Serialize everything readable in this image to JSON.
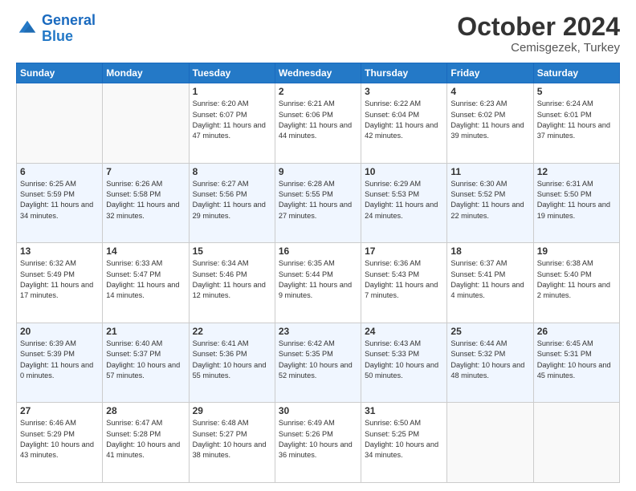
{
  "header": {
    "logo_line1": "General",
    "logo_line2": "Blue",
    "month": "October 2024",
    "location": "Cemisgezek, Turkey"
  },
  "weekdays": [
    "Sunday",
    "Monday",
    "Tuesday",
    "Wednesday",
    "Thursday",
    "Friday",
    "Saturday"
  ],
  "weeks": [
    [
      {
        "day": "",
        "info": ""
      },
      {
        "day": "",
        "info": ""
      },
      {
        "day": "1",
        "info": "Sunrise: 6:20 AM\nSunset: 6:07 PM\nDaylight: 11 hours and 47 minutes."
      },
      {
        "day": "2",
        "info": "Sunrise: 6:21 AM\nSunset: 6:06 PM\nDaylight: 11 hours and 44 minutes."
      },
      {
        "day": "3",
        "info": "Sunrise: 6:22 AM\nSunset: 6:04 PM\nDaylight: 11 hours and 42 minutes."
      },
      {
        "day": "4",
        "info": "Sunrise: 6:23 AM\nSunset: 6:02 PM\nDaylight: 11 hours and 39 minutes."
      },
      {
        "day": "5",
        "info": "Sunrise: 6:24 AM\nSunset: 6:01 PM\nDaylight: 11 hours and 37 minutes."
      }
    ],
    [
      {
        "day": "6",
        "info": "Sunrise: 6:25 AM\nSunset: 5:59 PM\nDaylight: 11 hours and 34 minutes."
      },
      {
        "day": "7",
        "info": "Sunrise: 6:26 AM\nSunset: 5:58 PM\nDaylight: 11 hours and 32 minutes."
      },
      {
        "day": "8",
        "info": "Sunrise: 6:27 AM\nSunset: 5:56 PM\nDaylight: 11 hours and 29 minutes."
      },
      {
        "day": "9",
        "info": "Sunrise: 6:28 AM\nSunset: 5:55 PM\nDaylight: 11 hours and 27 minutes."
      },
      {
        "day": "10",
        "info": "Sunrise: 6:29 AM\nSunset: 5:53 PM\nDaylight: 11 hours and 24 minutes."
      },
      {
        "day": "11",
        "info": "Sunrise: 6:30 AM\nSunset: 5:52 PM\nDaylight: 11 hours and 22 minutes."
      },
      {
        "day": "12",
        "info": "Sunrise: 6:31 AM\nSunset: 5:50 PM\nDaylight: 11 hours and 19 minutes."
      }
    ],
    [
      {
        "day": "13",
        "info": "Sunrise: 6:32 AM\nSunset: 5:49 PM\nDaylight: 11 hours and 17 minutes."
      },
      {
        "day": "14",
        "info": "Sunrise: 6:33 AM\nSunset: 5:47 PM\nDaylight: 11 hours and 14 minutes."
      },
      {
        "day": "15",
        "info": "Sunrise: 6:34 AM\nSunset: 5:46 PM\nDaylight: 11 hours and 12 minutes."
      },
      {
        "day": "16",
        "info": "Sunrise: 6:35 AM\nSunset: 5:44 PM\nDaylight: 11 hours and 9 minutes."
      },
      {
        "day": "17",
        "info": "Sunrise: 6:36 AM\nSunset: 5:43 PM\nDaylight: 11 hours and 7 minutes."
      },
      {
        "day": "18",
        "info": "Sunrise: 6:37 AM\nSunset: 5:41 PM\nDaylight: 11 hours and 4 minutes."
      },
      {
        "day": "19",
        "info": "Sunrise: 6:38 AM\nSunset: 5:40 PM\nDaylight: 11 hours and 2 minutes."
      }
    ],
    [
      {
        "day": "20",
        "info": "Sunrise: 6:39 AM\nSunset: 5:39 PM\nDaylight: 11 hours and 0 minutes."
      },
      {
        "day": "21",
        "info": "Sunrise: 6:40 AM\nSunset: 5:37 PM\nDaylight: 10 hours and 57 minutes."
      },
      {
        "day": "22",
        "info": "Sunrise: 6:41 AM\nSunset: 5:36 PM\nDaylight: 10 hours and 55 minutes."
      },
      {
        "day": "23",
        "info": "Sunrise: 6:42 AM\nSunset: 5:35 PM\nDaylight: 10 hours and 52 minutes."
      },
      {
        "day": "24",
        "info": "Sunrise: 6:43 AM\nSunset: 5:33 PM\nDaylight: 10 hours and 50 minutes."
      },
      {
        "day": "25",
        "info": "Sunrise: 6:44 AM\nSunset: 5:32 PM\nDaylight: 10 hours and 48 minutes."
      },
      {
        "day": "26",
        "info": "Sunrise: 6:45 AM\nSunset: 5:31 PM\nDaylight: 10 hours and 45 minutes."
      }
    ],
    [
      {
        "day": "27",
        "info": "Sunrise: 6:46 AM\nSunset: 5:29 PM\nDaylight: 10 hours and 43 minutes."
      },
      {
        "day": "28",
        "info": "Sunrise: 6:47 AM\nSunset: 5:28 PM\nDaylight: 10 hours and 41 minutes."
      },
      {
        "day": "29",
        "info": "Sunrise: 6:48 AM\nSunset: 5:27 PM\nDaylight: 10 hours and 38 minutes."
      },
      {
        "day": "30",
        "info": "Sunrise: 6:49 AM\nSunset: 5:26 PM\nDaylight: 10 hours and 36 minutes."
      },
      {
        "day": "31",
        "info": "Sunrise: 6:50 AM\nSunset: 5:25 PM\nDaylight: 10 hours and 34 minutes."
      },
      {
        "day": "",
        "info": ""
      },
      {
        "day": "",
        "info": ""
      }
    ]
  ]
}
